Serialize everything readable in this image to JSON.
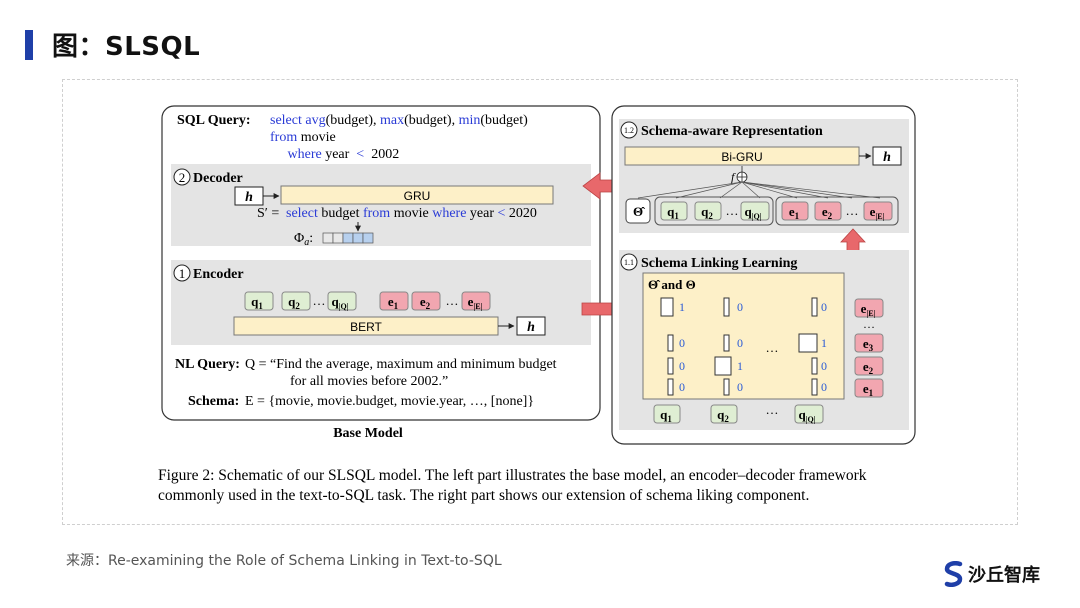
{
  "slide": {
    "title": "图：SLSQL",
    "source": "来源：Re-examining the Role of Schema Linking in Text-to-SQL",
    "logo_text": "沙丘智库"
  },
  "figure": {
    "sql_query_label": "SQL Query:",
    "sql_line1_parts": [
      "select",
      " ",
      "avg",
      "(budget), ",
      "max",
      "(budget), ",
      "min",
      "(budget)"
    ],
    "sql_line2_parts": [
      "from",
      " movie"
    ],
    "sql_line3_parts": [
      "where",
      " year  ",
      "<",
      "  2002"
    ],
    "decoder_num": "2",
    "decoder_label": "Decoder",
    "gru_label": "GRU",
    "h_label": "h",
    "s_prime_prefix": "S′ =",
    "s_prime_parts": [
      "select",
      " budget ",
      "from",
      " movie ",
      "where",
      " year ",
      "<",
      " 2020"
    ],
    "phi_label": "Φ",
    "phi_sub": "a",
    "phi_colon": ":",
    "encoder_num": "1",
    "encoder_label": "Encoder",
    "bert_label": "BERT",
    "q_tokens": [
      "q",
      "q",
      "q"
    ],
    "q_subs": [
      "1",
      "2",
      "|Q|"
    ],
    "e_tokens": [
      "e",
      "e",
      "e"
    ],
    "e_subs": [
      "1",
      "2",
      "|E|"
    ],
    "ellipsis": "…",
    "nl_query_label": "NL Query:",
    "nl_query_line1": "Q = “Find the average, maximum and minimum budget",
    "nl_query_line2": "for all movies before 2002.”",
    "schema_label": "Schema:",
    "schema_value": "E = {movie, movie.budget, movie.year, …, [none]}",
    "base_model_label": "Base Model",
    "sar_num": "1.2",
    "sar_label": "Schema-aware Representation",
    "bigru_label": "Bi-GRU",
    "f_label": "f",
    "theta_hat": "Θ̂",
    "sll_num": "1.1",
    "sll_label": "Schema Linking Learning",
    "theta_and": "Θ̂ and Θ",
    "matrix_values": [
      [
        "1",
        "0",
        "0"
      ],
      [
        "0",
        "0",
        "1"
      ],
      [
        "0",
        "1",
        "0"
      ],
      [
        "0",
        "0",
        "0"
      ]
    ],
    "right_e_subs": [
      "|E|",
      "3",
      "2",
      "1"
    ],
    "caption_line1": "Figure 2: Schematic of our SLSQL model. The left part illustrates the base model, an encoder–decoder framework",
    "caption_line2": "commonly used in the text-to-SQL task. The right part shows our extension of schema liking component."
  },
  "colors": {
    "keyword_blue": "#2a3bd6",
    "q_green": "#dfeed3",
    "e_pink": "#f2a6b0",
    "panel_gray": "#e4e4e4",
    "gru_yellow": "#fdf0c8",
    "arrow_red": "#e8686b",
    "title_bar": "#1f3fa8"
  }
}
